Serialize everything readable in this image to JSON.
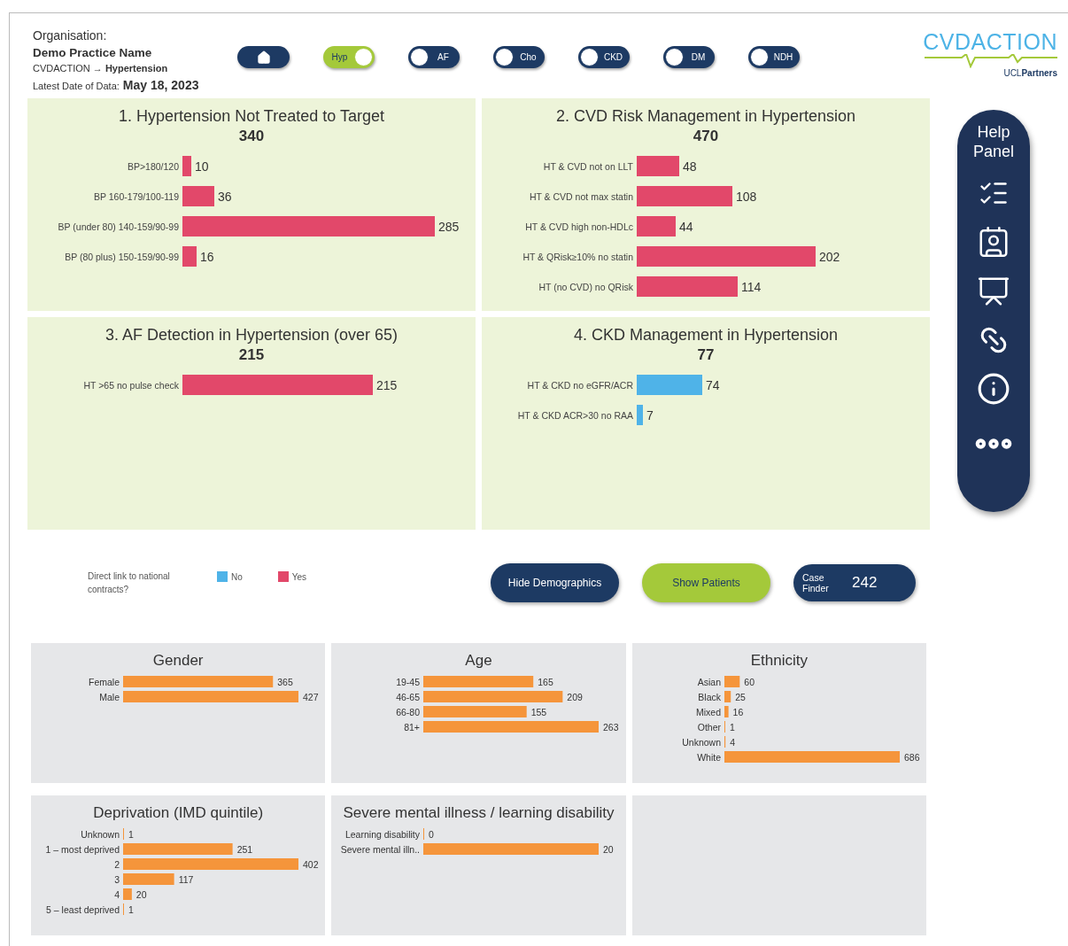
{
  "header": {
    "organisation_label": "Organisation:",
    "practice_name": "Demo Practice Name",
    "breadcrumb": "CVDACTION → **Hypertension**",
    "date_label": "Latest Date of Data:",
    "date": "May 18, 2023"
  },
  "toggles": [
    {
      "label": "Hyp",
      "on": true
    },
    {
      "label": "AF",
      "on": false
    },
    {
      "label": "Cho",
      "on": false
    },
    {
      "label": "CKD",
      "on": false
    },
    {
      "label": "DM",
      "on": false
    },
    {
      "label": "NDH",
      "on": false
    }
  ],
  "logo": {
    "wordmark": "CVDACTION",
    "partner": "UCL**Partners**"
  },
  "panels": [
    {
      "title": "1. Hypertension Not Treated to Target",
      "total": "340",
      "chart_data": {
        "type": "bar",
        "orientation": "horizontal",
        "data_labels": true,
        "categories": [
          "BP>180/120",
          "BP 160-179/100-119",
          "BP (under 80) 140-159/90-99",
          "BP (80 plus) 150-159/90-99"
        ],
        "series": [
          {
            "color": "#e2486a",
            "values": [
              10,
              36,
              285,
              16
            ]
          }
        ]
      }
    },
    {
      "title": "2. CVD Risk Management in Hypertension",
      "total": "470",
      "chart_data": {
        "type": "bar",
        "orientation": "horizontal",
        "data_labels": true,
        "categories": [
          "HT & CVD not on LLT",
          "HT & CVD not max statin",
          "HT & CVD high non-HDLc",
          "HT & QRisk≥10% no statin",
          "HT (no CVD) no QRisk"
        ],
        "series": [
          {
            "color": "#e2486a",
            "values": [
              48,
              108,
              44,
              202,
              114
            ]
          }
        ]
      }
    },
    {
      "title": "3. AF Detection in Hypertension (over 65)",
      "total": "215",
      "chart_data": {
        "type": "bar",
        "orientation": "horizontal",
        "data_labels": true,
        "categories": [
          "HT >65 no pulse check"
        ],
        "series": [
          {
            "color": "#e2486a",
            "values": [
              215
            ]
          }
        ]
      }
    },
    {
      "title": "4. CKD Management in Hypertension",
      "total": "77",
      "chart_data": {
        "type": "bar",
        "orientation": "horizontal",
        "data_labels": true,
        "categories": [
          "HT & CKD no eGFR/ACR",
          "HT & CKD ACR>30 no RAA"
        ],
        "series": [
          {
            "color": "#4fb3e8",
            "values": [
              74,
              7
            ]
          }
        ]
      }
    }
  ],
  "legend": {
    "title": "Direct link to national contracts?",
    "items": [
      {
        "label": "No",
        "color": "#4fb3e8"
      },
      {
        "label": "Yes",
        "color": "#e2486a"
      }
    ]
  },
  "buttons": [
    {
      "kind": "dark",
      "label": "Hide Demographics"
    },
    {
      "kind": "green",
      "label": "Show Patients"
    },
    {
      "kind": "case",
      "label": "Case Finder",
      "count": "242"
    }
  ],
  "demographics": [
    {
      "title": "Gender",
      "chart_data": {
        "type": "bar",
        "orientation": "horizontal",
        "data_labels": true,
        "categories": [
          "Female",
          "Male"
        ],
        "series": [
          {
            "color": "#f5953b",
            "values": [
              365,
              427
            ]
          }
        ]
      }
    },
    {
      "title": "Age",
      "chart_data": {
        "type": "bar",
        "orientation": "horizontal",
        "data_labels": true,
        "categories": [
          "19-45",
          "46-65",
          "66-80",
          "81+"
        ],
        "series": [
          {
            "color": "#f5953b",
            "values": [
              165,
              209,
              155,
              263
            ]
          }
        ]
      }
    },
    {
      "title": "Ethnicity",
      "chart_data": {
        "type": "bar",
        "orientation": "horizontal",
        "data_labels": true,
        "categories": [
          "Asian",
          "Black",
          "Mixed",
          "Other",
          "Unknown",
          "White"
        ],
        "series": [
          {
            "color": "#f5953b",
            "values": [
              60,
              25,
              16,
              1,
              4,
              686
            ]
          }
        ]
      }
    },
    {
      "title": "Deprivation (IMD quintile)",
      "chart_data": {
        "type": "bar",
        "orientation": "horizontal",
        "data_labels": true,
        "categories": [
          "Unknown",
          "1 – most deprived",
          "2",
          "3",
          "4",
          "5 – least deprived"
        ],
        "series": [
          {
            "color": "#f5953b",
            "values": [
              1,
              251,
              402,
              117,
              20,
              1
            ]
          }
        ]
      }
    },
    {
      "title": "Severe mental illness / learning disability",
      "chart_data": {
        "type": "bar",
        "orientation": "horizontal",
        "data_labels": true,
        "categories": [
          "Learning disability",
          "Severe mental illn.."
        ],
        "series": [
          {
            "color": "#f5953b",
            "values": [
              0,
              20
            ]
          }
        ]
      }
    }
  ],
  "help_panel": {
    "title": "Help Panel"
  }
}
